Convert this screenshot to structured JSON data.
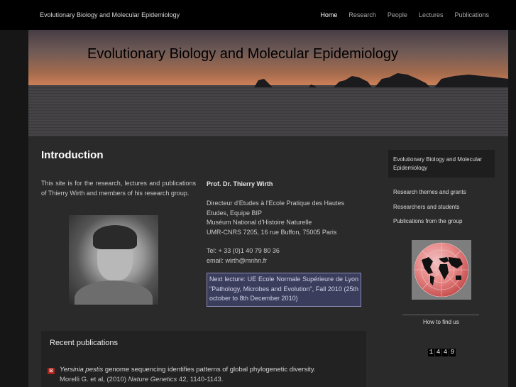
{
  "header": {
    "site_name": "Evolutionary Biology and Molecular Epidemiology",
    "nav": [
      {
        "label": "Home",
        "active": true
      },
      {
        "label": "Research",
        "active": false
      },
      {
        "label": "People",
        "active": false
      },
      {
        "label": "Lectures",
        "active": false
      },
      {
        "label": "Publications",
        "active": false
      }
    ]
  },
  "banner": {
    "title": "Evolutionary Biology and Molecular Epidemiology"
  },
  "intro": {
    "title": "Introduction",
    "text": "This site is for the research, lectures and publications of Thierry Wirth and members of his research group."
  },
  "profile": {
    "name": "Prof. Dr. Thierry Wirth",
    "lines": [
      "Directeur d'Etudes à l'Ecole Pratique des Hautes",
      "Etudes, Equipe BIP",
      "Muséum National d'Histoire Naturelle",
      "UMR-CNRS 7205, 16 rue Buffon, 75005 Paris"
    ],
    "tel": "Tel: + 33 (0)1 40 79 80 36",
    "email": "email: wirth@mnhn.fr",
    "lecture_notice": "Next lecture: UE Ecole Normale Supérieure de Lyon \"Pathology, Microbes and Evolution\", Fall 2010 (25th october to 8th December 2010)"
  },
  "publications": {
    "title": "Recent publications",
    "items": [
      {
        "species": "Yersinia pestis",
        "title_rest": " genome sequencing identifies patterns of global phylogenetic diversity.",
        "authors": "Morelli G. et al, (2010) ",
        "journal": "Nature Genetics",
        "citation": " 42, 1140-1143."
      }
    ]
  },
  "sidebar": {
    "title": "Evolutionary Biology and Molecular Epidemiology",
    "links": [
      "Research themes and grants",
      "Researchers and students",
      "Publications from the group"
    ],
    "find_us": "How to find us",
    "counter_digits": [
      "1",
      "4",
      "4",
      "9"
    ]
  },
  "colors": {
    "background": "#161616",
    "content_bg": "#2a2a2a",
    "lecture_box": "#3b3d5c",
    "pub_icon": "#a8221c"
  }
}
